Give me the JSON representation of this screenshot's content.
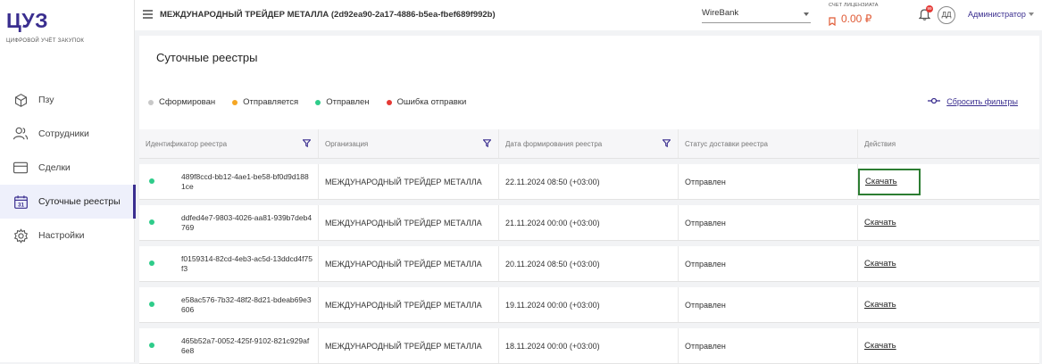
{
  "brand": {
    "logo": "ЦУЗ",
    "subtitle": "ЦИФРОВОЙ УЧЁТ ЗАКУПОК"
  },
  "sidebar": {
    "items": [
      {
        "label": "Пзу",
        "icon": "box-icon",
        "active": false
      },
      {
        "label": "Сотрудники",
        "icon": "users-icon",
        "active": false
      },
      {
        "label": "Сделки",
        "icon": "card-icon",
        "active": false
      },
      {
        "label": "Суточные реестры",
        "icon": "calendar-icon",
        "active": true
      },
      {
        "label": "Настройки",
        "icon": "gear-icon",
        "active": false
      }
    ]
  },
  "header": {
    "org_title": "МЕЖДУНАРОДНЫЙ ТРЕЙДЕР МЕТАЛЛА (2d92ea90-2a17-4886-b5ea-fbef689f992b)",
    "bank": "WireBank",
    "account_label": "СЧЕТ ЛИЦЕНЗИАТА",
    "account_value": "0.00 ₽",
    "notifications_badge": "99",
    "avatar": "ДД",
    "user": "Администратор"
  },
  "page": {
    "title": "Суточные реестры",
    "reset_filters": "Сбросить фильтры",
    "legend": [
      {
        "label": "Сформирован",
        "color": "#c8c8c8"
      },
      {
        "label": "Отправляется",
        "color": "#f5a623"
      },
      {
        "label": "Отправлен",
        "color": "#2ecc8a"
      },
      {
        "label": "Ошибка отправки",
        "color": "#e53935"
      }
    ]
  },
  "table": {
    "columns": [
      "Идентификатор реестра",
      "Организация",
      "Дата формирования реестра",
      "Статус доставки реестра",
      "Действия"
    ],
    "rows": [
      {
        "id": "489f8ccd-bb12-4ae1-be58-bf0d9d1881ce",
        "org": "МЕЖДУНАРОДНЫЙ ТРЕЙДЕР МЕТАЛЛА",
        "date": "22.11.2024 08:50 (+03:00)",
        "status": "Отправлен",
        "action": "Скачать"
      },
      {
        "id": "ddfed4e7-9803-4026-aa81-939b7deb4769",
        "org": "МЕЖДУНАРОДНЫЙ ТРЕЙДЕР МЕТАЛЛА",
        "date": "21.11.2024 00:00 (+03:00)",
        "status": "Отправлен",
        "action": "Скачать"
      },
      {
        "id": "f0159314-82cd-4eb3-ac5d-13ddcd4f75f3",
        "org": "МЕЖДУНАРОДНЫЙ ТРЕЙДЕР МЕТАЛЛА",
        "date": "20.11.2024 08:50 (+03:00)",
        "status": "Отправлен",
        "action": "Скачать"
      },
      {
        "id": "e58ac576-7b32-48f2-8d21-bdeab69e3606",
        "org": "МЕЖДУНАРОДНЫЙ ТРЕЙДЕР МЕТАЛЛА",
        "date": "19.11.2024 00:00 (+03:00)",
        "status": "Отправлен",
        "action": "Скачать"
      },
      {
        "id": "465b52a7-0052-425f-9102-821c929af6e8",
        "org": "МЕЖДУНАРОДНЫЙ ТРЕЙДЕР МЕТАЛЛА",
        "date": "18.11.2024 00:00 (+03:00)",
        "status": "Отправлен",
        "action": "Скачать"
      }
    ]
  }
}
